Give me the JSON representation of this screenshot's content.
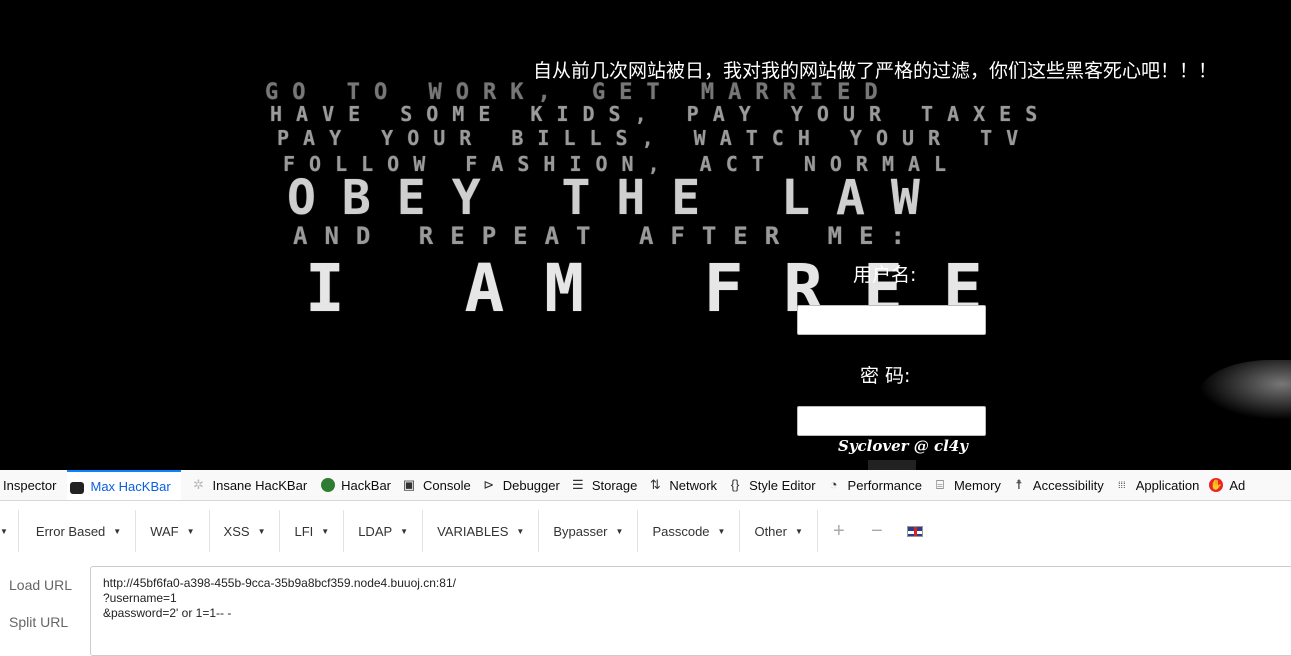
{
  "page": {
    "headline": "自从前几次网站被日，我对我的网站做了严格的过滤，你们这些黑客死心吧！！！",
    "poster_lines": [
      "GO TO WORK, GET MARRIED",
      "HAVE SOME KIDS, PAY YOUR TAXES",
      "PAY YOUR BILLS, WATCH YOUR TV",
      "FOLLOW FASHION, ACT NORMAL",
      "OBEY THE LAW",
      "AND REPEAT AFTER ME:",
      "I AM FREE"
    ],
    "username_label": "用户名:",
    "password_label": "密 码:",
    "username_value": "",
    "password_value": "",
    "credit": "Syclover @ cl4y"
  },
  "devtools": {
    "tabs": [
      {
        "label": "Inspector",
        "icon": "inspector-icon",
        "glyph": ""
      },
      {
        "label": "Max HacKBar",
        "icon": "lock-icon",
        "glyph": "",
        "active": true
      },
      {
        "label": "Insane HacKBar",
        "icon": "puzzle-icon",
        "glyph": "✲"
      },
      {
        "label": "HackBar",
        "icon": "hackbar-icon",
        "glyph": ""
      },
      {
        "label": "Console",
        "icon": "console-icon",
        "glyph": "▣"
      },
      {
        "label": "Debugger",
        "icon": "debugger-icon",
        "glyph": "⊳"
      },
      {
        "label": "Storage",
        "icon": "storage-icon",
        "glyph": "☰"
      },
      {
        "label": "Network",
        "icon": "network-icon",
        "glyph": "⇅"
      },
      {
        "label": "Style Editor",
        "icon": "style-editor-icon",
        "glyph": "{}"
      },
      {
        "label": "Performance",
        "icon": "performance-icon",
        "glyph": "◔"
      },
      {
        "label": "Memory",
        "icon": "memory-icon",
        "glyph": "⌸"
      },
      {
        "label": "Accessibility",
        "icon": "accessibility-icon",
        "glyph": "☨"
      },
      {
        "label": "Application",
        "icon": "application-icon",
        "glyph": "⁞⁞⁞"
      },
      {
        "label": "Ad",
        "icon": "adblock-icon",
        "glyph": "✋"
      }
    ]
  },
  "hackbar": {
    "menus": [
      "Error Based",
      "WAF",
      "XSS",
      "LFI",
      "LDAP",
      "VARIABLES",
      "Bypasser",
      "Passcode",
      "Other"
    ],
    "add_label": "+",
    "remove_label": "−",
    "load_url_label": "Load URL",
    "split_url_label": "Split URL",
    "url_value": "http://45bf6fa0-a398-455b-9cca-35b9a8bcf359.node4.buuoj.cn:81/\n?username=1\n&password=2' or 1=1-- -"
  }
}
